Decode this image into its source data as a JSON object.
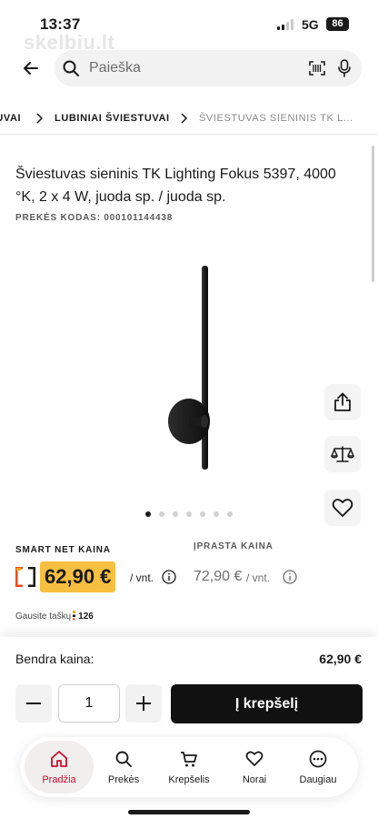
{
  "status_bar": {
    "time": "13:37",
    "network": "5G",
    "battery": "86"
  },
  "watermark": "skelbiu.lt",
  "search": {
    "placeholder": "Paieška"
  },
  "breadcrumb": [
    {
      "label": "TUVAI"
    },
    {
      "label": "LUBINIAI ŠVIESTUVAI"
    },
    {
      "label": "ŠVIESTUVAS SIENINIS TK L..."
    }
  ],
  "product": {
    "title": "Šviestuvas sieninis TK Lighting Fokus 5397, 4000 °K, 2 x 4 W, juoda sp. / juoda sp.",
    "code": "PREKĖS KODAS: 000101144438"
  },
  "gallery": {
    "slides": 7,
    "active": 0
  },
  "pricing": {
    "smart_label": "SMART NET KAINA",
    "smart_price": "62,90 €",
    "smart_unit": "/ vnt.",
    "regular_label": "ĮPRASTA KAINA",
    "regular_price": "72,90 €",
    "regular_unit": "/ vnt.",
    "points_label": "Gausite taškų",
    "points_value": "126"
  },
  "cart": {
    "total_label": "Bendra kaina:",
    "total_value": "62,90 €",
    "quantity": "1",
    "add_label": "Į krepšelį"
  },
  "tabbar": [
    {
      "label": "Pradžia",
      "icon": "home-icon",
      "active": true
    },
    {
      "label": "Prekės",
      "icon": "search-icon",
      "active": false
    },
    {
      "label": "Krepšelis",
      "icon": "cart-icon",
      "active": false
    },
    {
      "label": "Norai",
      "icon": "heart-icon",
      "active": false
    },
    {
      "label": "Daugiau",
      "icon": "more-icon",
      "active": false
    }
  ],
  "colors": {
    "price_badge": "#f7bf3f",
    "accent": "#c8102e",
    "button": "#111111"
  }
}
